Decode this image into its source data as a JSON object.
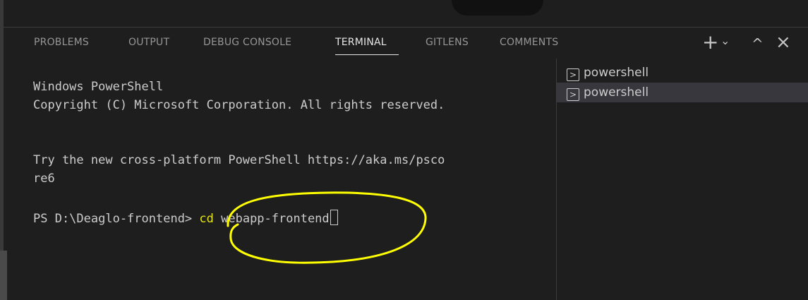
{
  "tabs": [
    {
      "label": "PROBLEMS"
    },
    {
      "label": "OUTPUT"
    },
    {
      "label": "DEBUG CONSOLE"
    },
    {
      "label": "TERMINAL"
    },
    {
      "label": "GITLENS"
    },
    {
      "label": "COMMENTS"
    }
  ],
  "active_tab": "TERMINAL",
  "actions": {
    "new_terminal": "+",
    "dropdown": "⌄",
    "maximize": "^",
    "close": "×"
  },
  "terminal": {
    "lines": [
      "Windows PowerShell",
      "Copyright (C) Microsoft Corporation. All rights reserved.",
      "",
      "",
      "Try the new cross-platform PowerShell https://aka.ms/psco",
      "re6",
      ""
    ],
    "prompt": "PS D:\\Deaglo-frontend> ",
    "command": "cd",
    "argument": " webapp-frontend"
  },
  "terminal_list": [
    {
      "label": "powershell",
      "icon": "terminal-icon"
    },
    {
      "label": "powershell",
      "icon": "terminal-icon"
    }
  ],
  "colors": {
    "background": "#1e1e1e",
    "annotation": "#ffff00",
    "command": "#e5e510",
    "selected_item": "#37373d"
  }
}
